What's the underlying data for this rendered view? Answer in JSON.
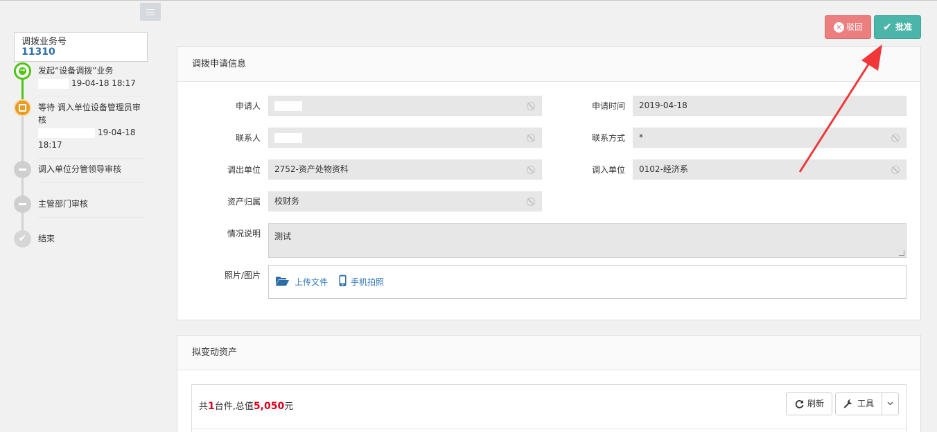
{
  "business_no": {
    "label": "调拨业务号",
    "value": "11310"
  },
  "steps": [
    {
      "title": "发起“设备调拨”业务",
      "time": "19-04-18 18:17",
      "status": "done"
    },
    {
      "title": "等待 调入单位设备管理员审核",
      "time": "19-04-18",
      "time2": "18:17",
      "status": "current"
    },
    {
      "title": "调入单位分管领导审核",
      "status": "pending"
    },
    {
      "title": "主管部门审核",
      "status": "pending"
    },
    {
      "title": "结束",
      "status": "end"
    }
  ],
  "actions": {
    "recall": "驳回",
    "approve": "批准"
  },
  "apply_panel": {
    "title": "调拨申请信息",
    "fields": {
      "applicant": {
        "label": "申请人",
        "value": ""
      },
      "apply_time": {
        "label": "申请时间",
        "value": "2019-04-18"
      },
      "contact": {
        "label": "联系人",
        "value": ""
      },
      "contact_method": {
        "label": "联系方式",
        "value": "*"
      },
      "out_unit": {
        "label": "调出单位",
        "value": "2752-资产处物资科"
      },
      "in_unit": {
        "label": "调入单位",
        "value": "0102-经济系"
      },
      "ownership": {
        "label": "资产归属",
        "value": "校财务"
      },
      "description": {
        "label": "情况说明",
        "value": "测试"
      },
      "photos": {
        "label": "照片/图片",
        "upload_label": "上传文件",
        "phone_label": "手机拍照"
      }
    }
  },
  "asset_panel": {
    "title": "拟变动资产",
    "summary_prefix": "共",
    "count": "1",
    "summary_mid": "台件,总值",
    "total": "5,050",
    "summary_suffix": "元",
    "refresh": "刷新",
    "tools": "工具"
  },
  "colors": {
    "danger": "#ec7e7f",
    "success": "#4cb5aa",
    "link": "#337ab7",
    "number": "#d9001b",
    "annotation_arrow": "#f0373a"
  }
}
